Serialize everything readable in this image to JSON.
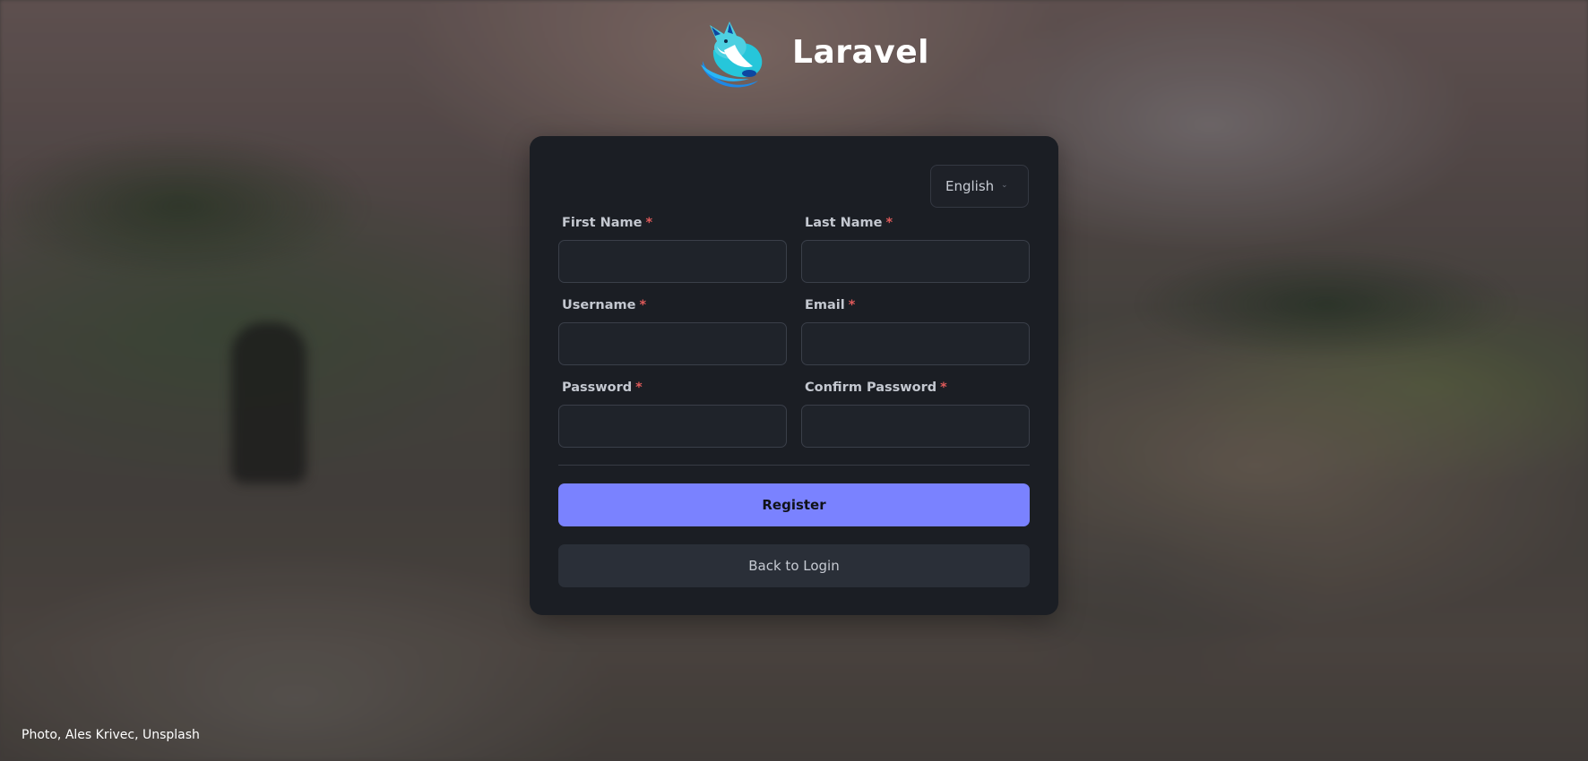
{
  "brand": {
    "name": "Laravel",
    "logo_icon": "fox-logo-icon"
  },
  "language_select": {
    "value": "English",
    "icon": "chevron-down-icon"
  },
  "form": {
    "first_name": {
      "label": "First Name",
      "required": "*",
      "value": ""
    },
    "last_name": {
      "label": "Last Name",
      "required": "*",
      "value": ""
    },
    "username": {
      "label": "Username",
      "required": "*",
      "value": ""
    },
    "email": {
      "label": "Email",
      "required": "*",
      "value": ""
    },
    "password": {
      "label": "Password",
      "required": "*",
      "value": ""
    },
    "confirm_password": {
      "label": "Confirm Password",
      "required": "*",
      "value": ""
    }
  },
  "actions": {
    "register_label": "Register",
    "back_label": "Back to Login"
  },
  "photo_credit": "Photo, Ales Krivec, Unsplash",
  "colors": {
    "primary": "#7a82ff",
    "card_bg": "#1b1e24",
    "required": "#e05a5a"
  }
}
